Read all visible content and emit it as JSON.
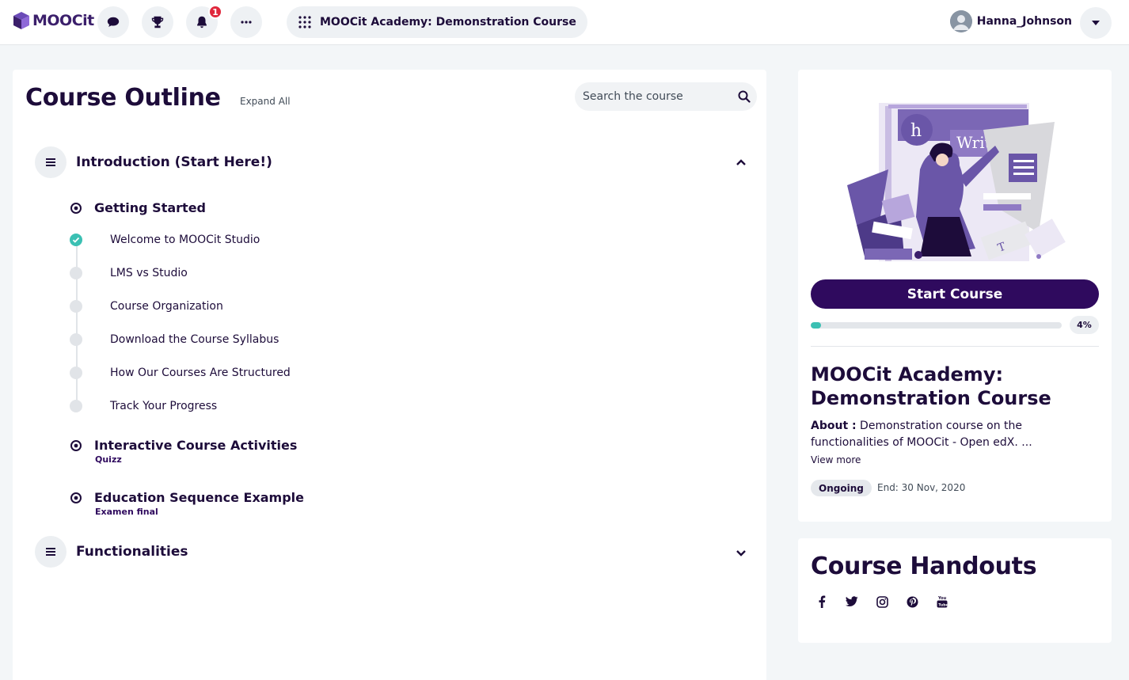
{
  "header": {
    "logo_text": "MOOCit",
    "notification_count": "1",
    "course_title": "MOOCit Academy: Demonstration Course",
    "user_name": "Hanna_Johnson"
  },
  "outline": {
    "title": "Course Outline",
    "expand_all": "Expand All",
    "search_placeholder": "Search the course",
    "sections": [
      {
        "title": "Introduction (Start Here!)",
        "subsections": [
          {
            "title": "Getting Started",
            "units": [
              {
                "label": "Welcome to MOOCit Studio",
                "complete": true
              },
              {
                "label": "LMS vs Studio",
                "complete": false
              },
              {
                "label": "Course Organization",
                "complete": false
              },
              {
                "label": "Download the Course Syllabus",
                "complete": false
              },
              {
                "label": "How Our Courses Are Structured",
                "complete": false
              },
              {
                "label": "Track Your Progress",
                "complete": false
              }
            ]
          },
          {
            "title": "Interactive Course Activities",
            "note": "Quizz"
          },
          {
            "title": "Education Sequence Example",
            "note": "Examen final"
          }
        ]
      },
      {
        "title": "Functionalities"
      }
    ]
  },
  "course_card": {
    "start_label": "Start Course",
    "progress": 0.04,
    "progress_label": "4%",
    "name": "MOOCit Academy: Demonstration Course",
    "about_label": "About :",
    "about_text": " Demonstration course on the functionalities of MOOCit - Open edX. ...",
    "view_more": "View more",
    "status": "Ongoing",
    "end_date": "End: 30 Nov, 2020",
    "hero_text": "Writing"
  },
  "handouts": {
    "title": "Course Handouts",
    "socials": [
      "facebook-icon",
      "twitter-icon",
      "instagram-icon",
      "pinterest-icon",
      "youtube-icon"
    ]
  },
  "colors": {
    "brand": "#2f0a5e",
    "progress": "#3bc0b3",
    "badge": "#e0283c"
  }
}
